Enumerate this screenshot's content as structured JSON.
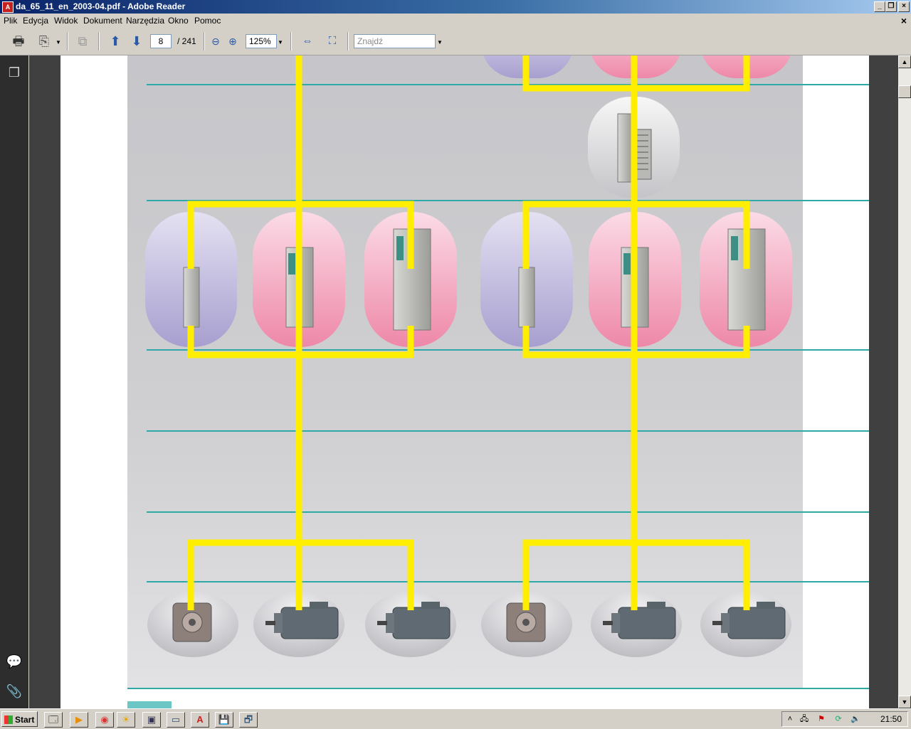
{
  "window": {
    "title": "da_65_11_en_2003-04.pdf - Adobe Reader",
    "app_icon": "pdf-icon",
    "controls": [
      "minimize",
      "restore",
      "close"
    ]
  },
  "menu": [
    "Plik",
    "Edycja",
    "Widok",
    "Dokument",
    "Narzędzia",
    "Okno",
    "Pomoc"
  ],
  "doc_close_label": "×",
  "toolbar": {
    "page_current": "8",
    "page_total": "/ 241",
    "zoom": "125%",
    "find_placeholder": "Znajdź"
  },
  "taskbar": {
    "start_label": "Start",
    "clock": "21:50"
  },
  "colors": {
    "bus": "#ffee00",
    "line": "#2fa8a8",
    "module_blue": "#a79fcf",
    "module_pink": "#ee88a8",
    "motor_bg": "#cfcfd3"
  }
}
